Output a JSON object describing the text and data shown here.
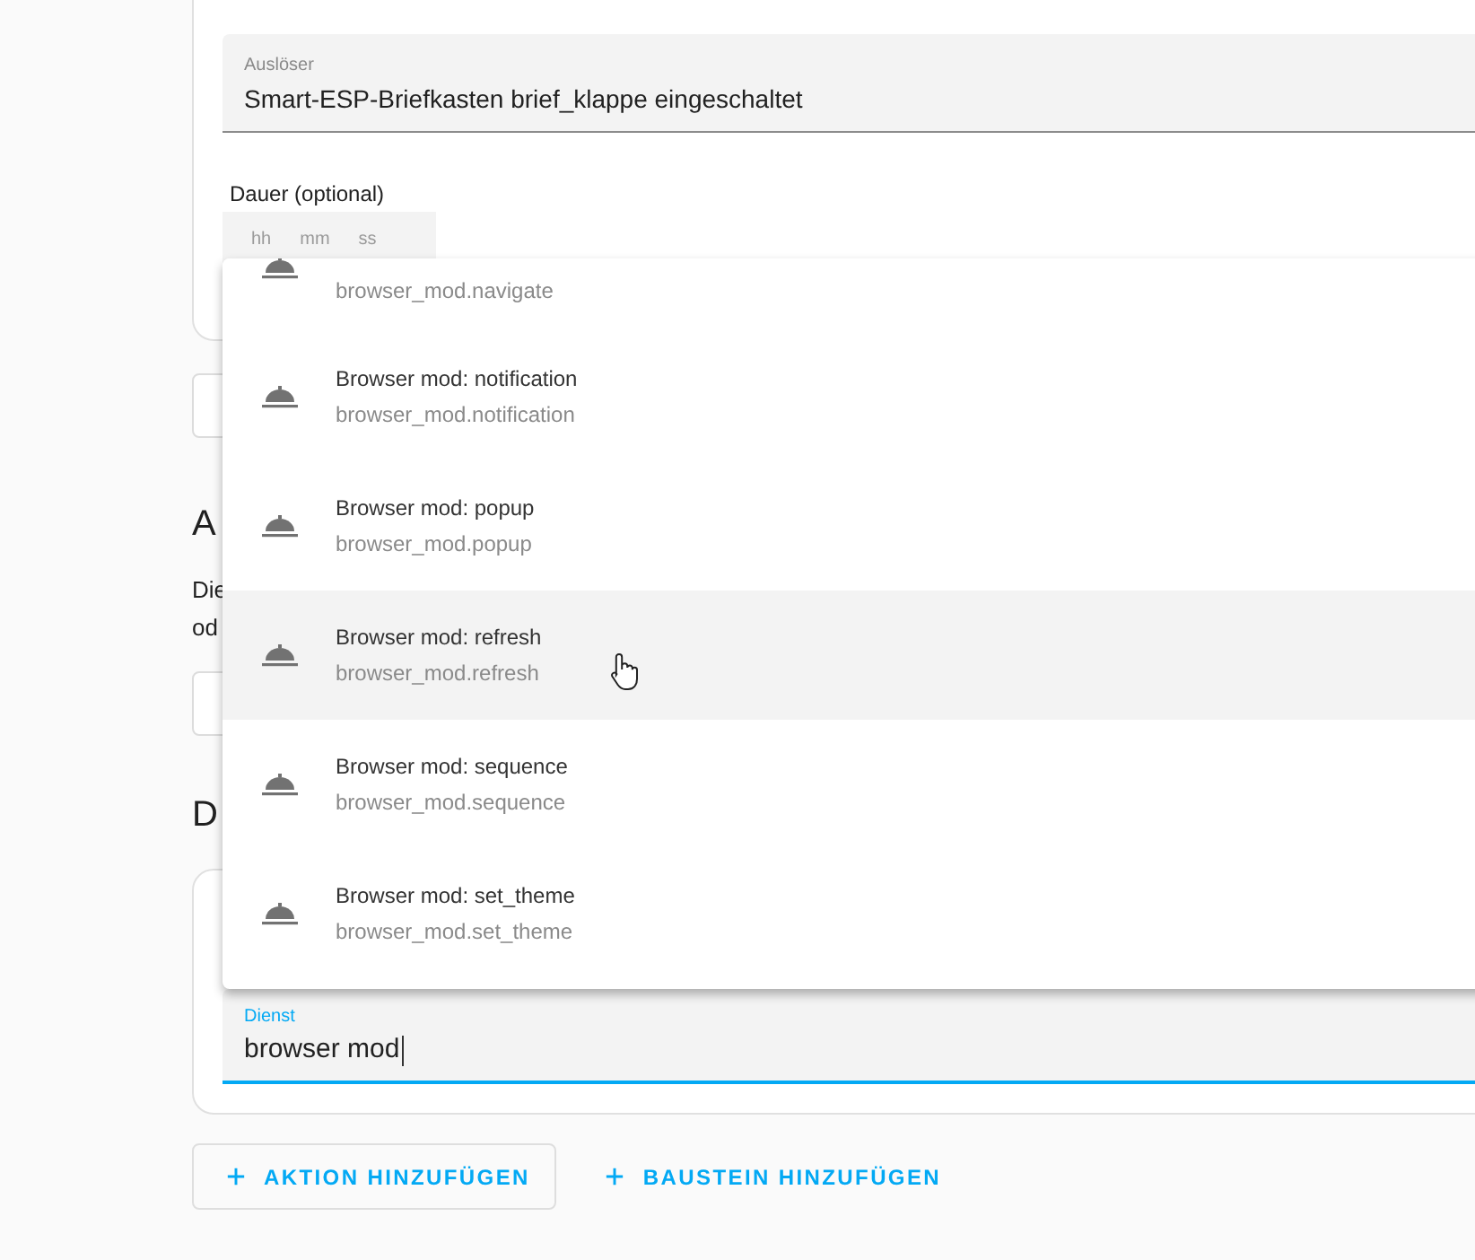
{
  "trigger_field": {
    "label": "Auslöser",
    "value": "Smart-ESP-Briefkasten brief_klappe eingeschaltet"
  },
  "duration": {
    "label": "Dauer (optional)",
    "units": [
      "hh",
      "mm",
      "ss"
    ]
  },
  "conditions_section": {
    "heading": "A",
    "description_lines": [
      "Die",
      "od"
    ]
  },
  "actions_section": {
    "heading": "D"
  },
  "service_field": {
    "label": "Dienst",
    "value": "browser mod",
    "focused": true
  },
  "dropdown": {
    "items": [
      {
        "service": "browser_mod.navigate",
        "hovered": false
      },
      {
        "title": "Browser mod: notification",
        "service": "browser_mod.notification",
        "hovered": false
      },
      {
        "title": "Browser mod: popup",
        "service": "browser_mod.popup",
        "hovered": false
      },
      {
        "title": "Browser mod: refresh",
        "service": "browser_mod.refresh",
        "hovered": true
      },
      {
        "title": "Browser mod: sequence",
        "service": "browser_mod.sequence",
        "hovered": false
      },
      {
        "title": "Browser mod: set_theme",
        "service": "browser_mod.set_theme",
        "hovered": false
      }
    ]
  },
  "buttons": [
    {
      "label": "AKTION HINZUFÜGEN",
      "kind": "outlined"
    },
    {
      "label": "BAUSTEIN HINZUFÜGEN",
      "kind": "text"
    }
  ]
}
